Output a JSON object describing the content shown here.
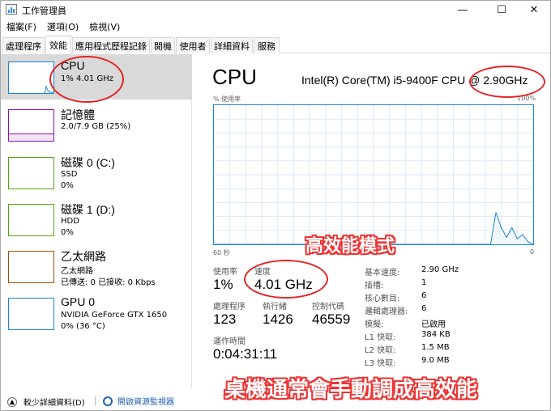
{
  "window": {
    "title": "工作管理員",
    "minimize": "—",
    "maximize": "☐",
    "close": "✕"
  },
  "menu": [
    "檔案(F)",
    "選項(O)",
    "檢視(V)"
  ],
  "tabs": [
    "處理程序",
    "效能",
    "應用程式歷程記錄",
    "開機",
    "使用者",
    "詳細資料",
    "服務"
  ],
  "active_tab": "效能",
  "resources": [
    {
      "name": "CPU",
      "line1": "1% 4.01 GHz",
      "line2": "",
      "color": "#1883d7"
    },
    {
      "name": "記憶體",
      "line1": "2.0/7.9 GB (25%)",
      "line2": "",
      "color": "#8b12ae"
    },
    {
      "name": "磁碟 0 (C:)",
      "line1": "SSD",
      "line2": "0%",
      "color": "#4da70a"
    },
    {
      "name": "磁碟 1 (D:)",
      "line1": "HDD",
      "line2": "0%",
      "color": "#4da70a"
    },
    {
      "name": "乙太網路",
      "line1": "乙太網路",
      "line2": "已傳送: 0 已接收: 0 Kbps",
      "color": "#a74f01"
    },
    {
      "name": "GPU 0",
      "line1": "NVIDIA GeForce GTX 1650",
      "line2": "0% (36 °C)",
      "color": "#1883d7"
    }
  ],
  "detail": {
    "title": "CPU",
    "model": "Intel(R) Core(TM) i5-9400F CPU @ 2.90GHz",
    "y_label": "% 使用率",
    "y_max": "100%",
    "x_left": "60 秒",
    "x_right": "0",
    "graph_line_color": "#1883d7",
    "graph_grid_color": "#d9eaf7",
    "usage_history": [
      0,
      0,
      0,
      0,
      0,
      0,
      0,
      0,
      0,
      0,
      0,
      0,
      0,
      0,
      0,
      0,
      0,
      0,
      0,
      0,
      0,
      0,
      0,
      0,
      0,
      0,
      0,
      0,
      0,
      0,
      0,
      0,
      0,
      0,
      0,
      0,
      0,
      0,
      0,
      0,
      0,
      0,
      0,
      0,
      0,
      0,
      0,
      0,
      0,
      0,
      0,
      0,
      0,
      23,
      12,
      5,
      12,
      4,
      7,
      2,
      0
    ]
  },
  "stats": {
    "usage_label": "使用率",
    "usage_value": "1%",
    "speed_label": "速度",
    "speed_value": "4.01 GHz",
    "processes_label": "處理程序",
    "processes_value": "123",
    "threads_label": "執行緒",
    "threads_value": "1426",
    "handles_label": "控制代碼",
    "handles_value": "46559",
    "uptime_label": "運作時間",
    "uptime_value": "0:04:31:11"
  },
  "specs": [
    {
      "k": "基本速度:",
      "v": "2.90 GHz"
    },
    {
      "k": "插槽:",
      "v": "1"
    },
    {
      "k": "核心數目:",
      "v": "6"
    },
    {
      "k": "邏輯處理器:",
      "v": "6"
    },
    {
      "k": "模擬:",
      "v": "已啟用"
    },
    {
      "k": "L1 快取:",
      "v": "384 KB"
    },
    {
      "k": "L2 快取:",
      "v": "1.5 MB"
    },
    {
      "k": "L3 快取:",
      "v": "9.0 MB"
    }
  ],
  "bottom": {
    "fewer_details": "較少詳細資料(D)",
    "resource_monitor": "開啟資源監視器"
  },
  "annotations": {
    "mode": "高效能模式",
    "note": "桌機通常會手動調成高效能",
    "color": "#e32424"
  }
}
